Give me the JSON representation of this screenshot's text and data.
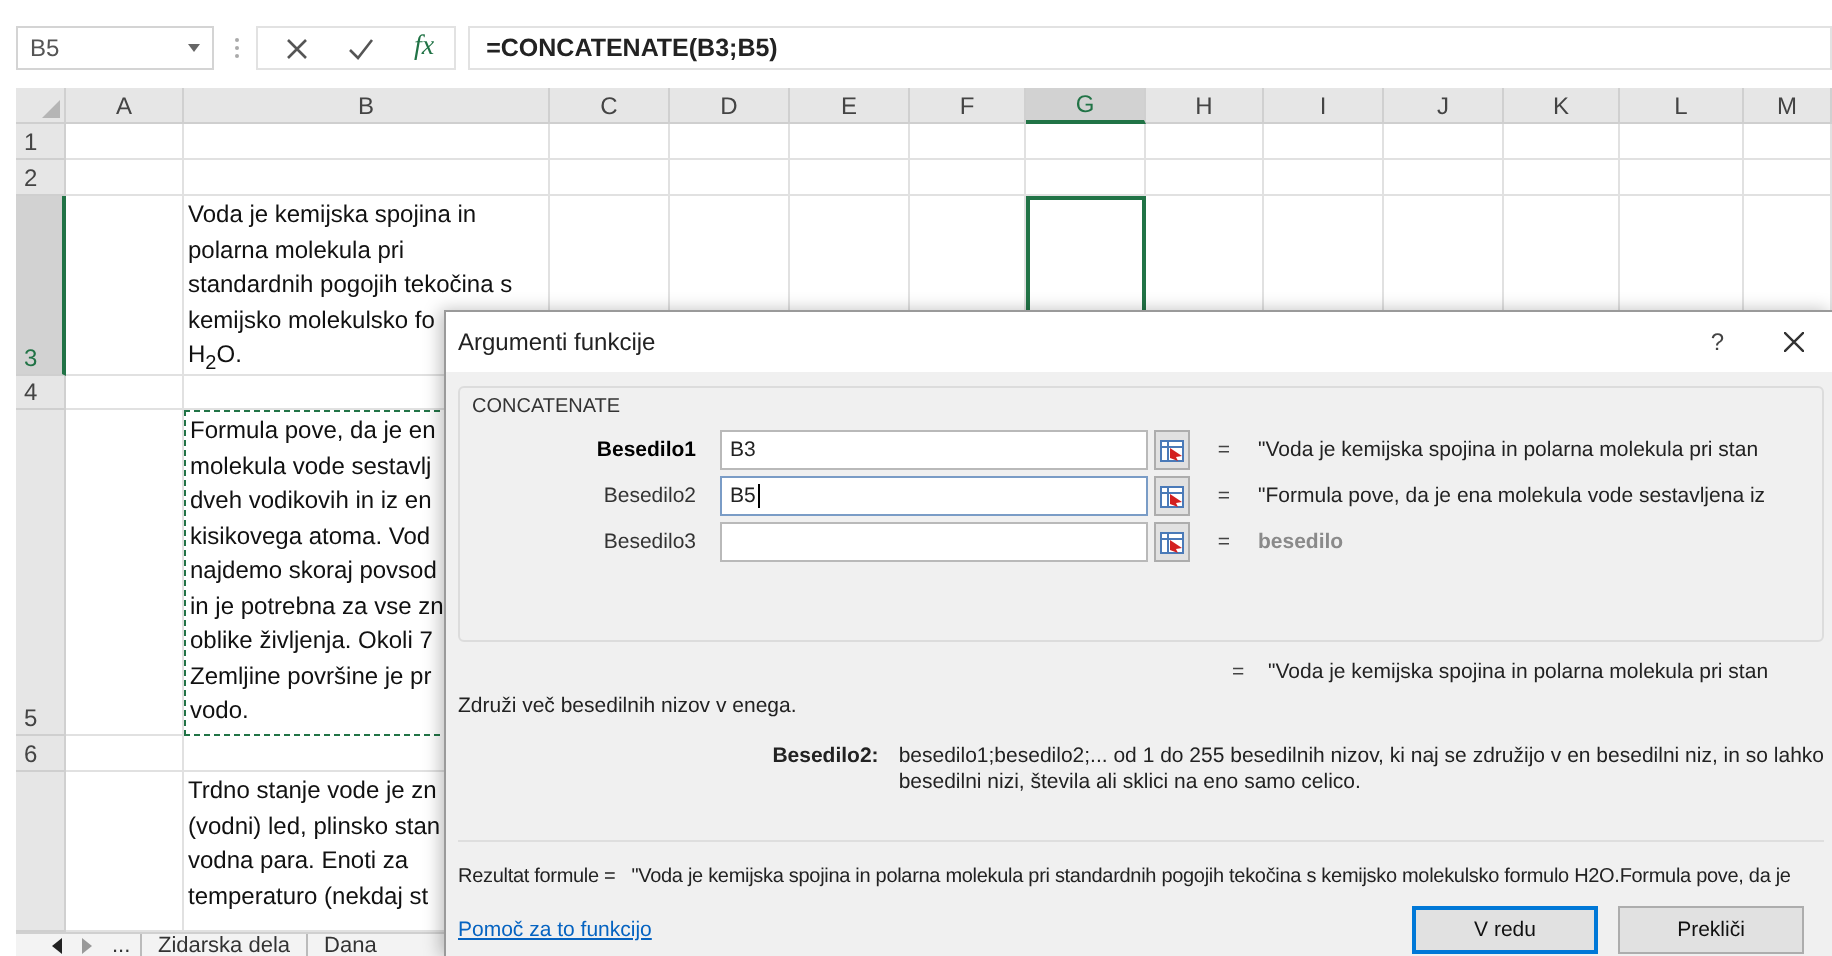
{
  "formula_bar": {
    "name_box": "B5",
    "fx": "fx",
    "formula": "=CONCATENATE(B3;B5)"
  },
  "sheet": {
    "columns": [
      {
        "label": "A",
        "selected": false
      },
      {
        "label": "B",
        "selected": false
      },
      {
        "label": "C",
        "selected": false
      },
      {
        "label": "D",
        "selected": false
      },
      {
        "label": "E",
        "selected": false
      },
      {
        "label": "F",
        "selected": false
      },
      {
        "label": "G",
        "selected": true
      },
      {
        "label": "H",
        "selected": false
      },
      {
        "label": "I",
        "selected": false
      },
      {
        "label": "J",
        "selected": false
      },
      {
        "label": "K",
        "selected": false
      },
      {
        "label": "L",
        "selected": false
      },
      {
        "label": "M",
        "selected": false
      }
    ],
    "rows": [
      {
        "label": "1",
        "selected": false
      },
      {
        "label": "2",
        "selected": false
      },
      {
        "label": "3",
        "selected": true,
        "cell_b": {
          "text": "Voda je kemijska spojina in\npolarna molekula pri\nstandardnih pogojih tekočina s\nkemijsko molekulsko fo\nH$_{2}$O.",
          "referenced": false
        },
        "cell_g": {
          "active": true
        }
      },
      {
        "label": "4",
        "selected": false
      },
      {
        "label": "5",
        "selected": false,
        "cell_b": {
          "text": "Formula pove, da je en\nmolekula vode sestavlj\ndveh vodikovih in iz en\nkisikovega atoma. Vod\nnajdemo skoraj povsod\nin je potrebna za vse zn\noblike življenja. Okoli 7\nZemljine površine je pr\nvodo.",
          "referenced": true
        }
      },
      {
        "label": "6",
        "selected": false
      },
      {
        "selected": false,
        "cell_b": {
          "text": "Trdno stanje vode je zn\n(vodni) led, plinsko stan\nvodna para. Enoti za\ntemperaturo (nekdaj st",
          "referenced": false
        }
      }
    ],
    "sheet_tabs": {
      "more": "...",
      "tabs": [
        {
          "label": "Zidarska dela",
          "selected": false
        },
        {
          "label": "Dana",
          "selected": false
        }
      ]
    }
  },
  "dialog": {
    "title": "Argumenti funkcije",
    "help": "?",
    "function_name": "CONCATENATE",
    "arguments": [
      {
        "label": "Besedilo1",
        "value": "B3",
        "focused": false,
        "required": true,
        "result": "\"Voda je kemijska spojina in polarna molekula pri stan",
        "muted": false
      },
      {
        "label": "Besedilo2",
        "value": "B5",
        "focused": true,
        "required": false,
        "result": "\"Formula pove, da je ena molekula vode sestavljena iz",
        "muted": false
      },
      {
        "label": "Besedilo3",
        "focused": false,
        "required": false,
        "result": "besedilo",
        "muted": true
      }
    ],
    "equals": "=",
    "function_result": "\"Voda je kemijska spojina in polarna molekula pri stan",
    "description": "Združi več besedilnih nizov v enega.",
    "argument_help": {
      "label": "Besedilo2:",
      "text": "besedilo1;besedilo2;... od 1 do 255 besedilnih nizov, ki naj se združijo v en besedilni niz, in so lahko\nbesedilni nizi, števila ali sklici na eno samo celico."
    },
    "formula_result_label": "Rezultat formule =",
    "formula_result": "\"Voda je kemijska spojina in polarna molekula pri standardnih pogojih tekočina s kemijsko molekulsko formulo H2O.Formula pove, da je",
    "help_link": "Pomoč za to funkcijo",
    "buttons": [
      {
        "label": "V redu",
        "default": true
      },
      {
        "label": "Prekliči",
        "default": false
      }
    ]
  }
}
